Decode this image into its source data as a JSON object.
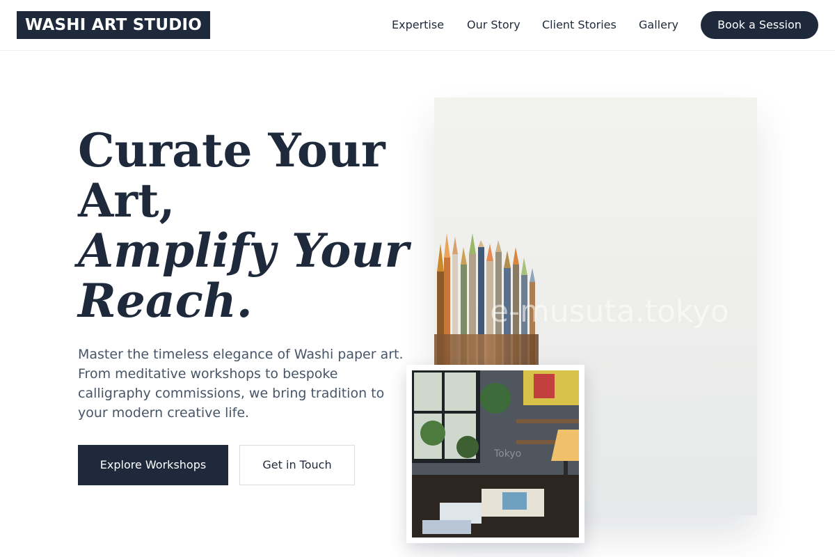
{
  "header": {
    "logo": "WASHI ART STUDIO",
    "nav": [
      "Expertise",
      "Our Story",
      "Client Stories",
      "Gallery"
    ],
    "cta": "Book a Session"
  },
  "hero": {
    "headline_line1": "Curate Your",
    "headline_line2": "Art,",
    "headline_line3": "Amplify Your",
    "headline_line4": "Reach.",
    "lead": "Master the timeless elegance of Washi paper art. From meditative workshops to bespoke calligraphy commissions, we bring tradition to your modern creative life.",
    "primary_button": "Explore Workshops",
    "secondary_button": "Get in Touch"
  },
  "images": {
    "main_watermark": "e-musuta.tokyo",
    "small_watermark": "Tokyo"
  },
  "colors": {
    "primary": "#1e293b",
    "text_muted": "#475569",
    "background": "#ffffff"
  }
}
